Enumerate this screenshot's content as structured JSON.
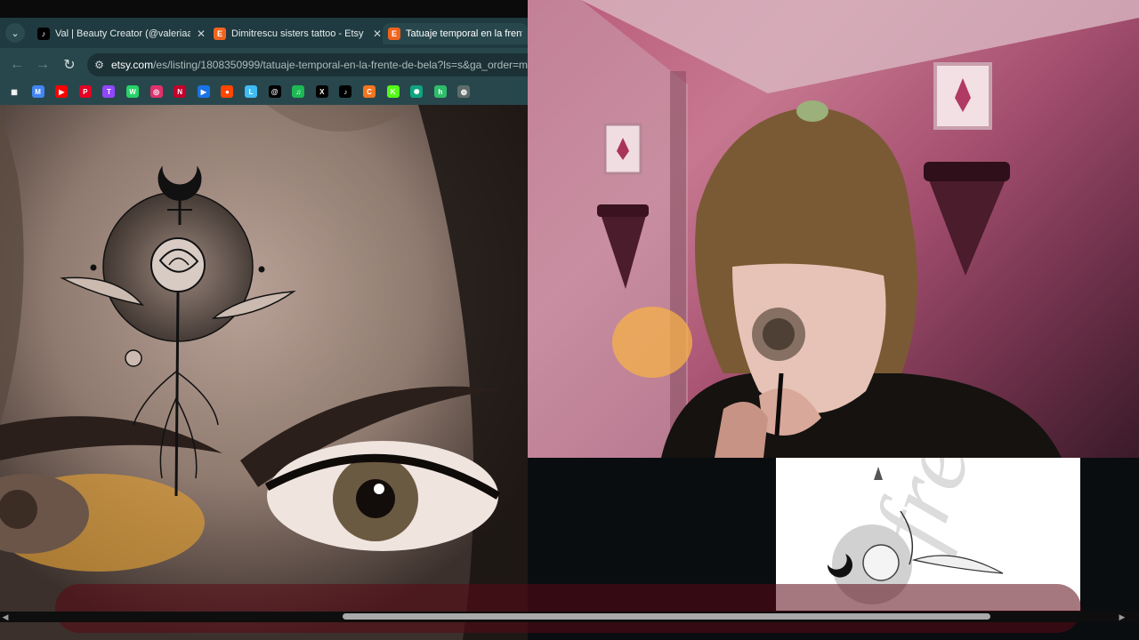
{
  "browser": {
    "tabs": [
      {
        "label": "Val | Beauty Creator (@valeriaa...",
        "icon": "tiktok-icon",
        "icon_bg": "#000000",
        "active": false
      },
      {
        "label": "Dimitrescu sisters tattoo - Etsy",
        "icon": "etsy-icon",
        "icon_bg": "#f1641e",
        "active": false
      },
      {
        "label": "Tatuaje temporal en la frente de",
        "icon": "etsy-icon",
        "icon_bg": "#f1641e",
        "active": true
      }
    ],
    "close_glyph": "✕",
    "etsy_letter": "E",
    "tiktok_letter": "♪",
    "menu_glyph": "⌄",
    "back_glyph": "←",
    "forward_glyph": "→",
    "reload_glyph": "↻",
    "site_info_glyph": "⚙",
    "url_host": "etsy.com",
    "url_path": "/es/listing/1808350999/tatuaje-temporal-en-la-frente-de-bela?ls=s&ga_order=m",
    "bookmarks": [
      {
        "name": "apps-icon",
        "color": "#28474d",
        "glyph": "▦"
      },
      {
        "name": "google-icon",
        "color": "#4285f4",
        "glyph": "M"
      },
      {
        "name": "youtube-icon",
        "color": "#ff0000",
        "glyph": "▶"
      },
      {
        "name": "pinterest-icon",
        "color": "#e60023",
        "glyph": "P"
      },
      {
        "name": "twitch-icon",
        "color": "#9146ff",
        "glyph": "T"
      },
      {
        "name": "whatsapp-icon",
        "color": "#25d366",
        "glyph": "W"
      },
      {
        "name": "instagram-icon",
        "color": "#e1306c",
        "glyph": "◎"
      },
      {
        "name": "bookmark-red-icon",
        "color": "#c4002b",
        "glyph": "N"
      },
      {
        "name": "video-icon",
        "color": "#1a73e8",
        "glyph": "▶"
      },
      {
        "name": "reddit-icon",
        "color": "#ff4500",
        "glyph": "●"
      },
      {
        "name": "letterboxd-icon",
        "color": "#40bcf4",
        "glyph": "L"
      },
      {
        "name": "threads-icon",
        "color": "#000000",
        "glyph": "@"
      },
      {
        "name": "spotify-icon",
        "color": "#1db954",
        "glyph": "♫"
      },
      {
        "name": "x-icon",
        "color": "#000000",
        "glyph": "X"
      },
      {
        "name": "tiktok-bookmark-icon",
        "color": "#000000",
        "glyph": "♪"
      },
      {
        "name": "crunchyroll-icon",
        "color": "#f47521",
        "glyph": "C"
      },
      {
        "name": "kick-icon",
        "color": "#53fc18",
        "glyph": "K"
      },
      {
        "name": "chatgpt-icon",
        "color": "#10a37f",
        "glyph": "✺"
      },
      {
        "name": "hotmart-icon",
        "color": "#2fbd6b",
        "glyph": "h"
      },
      {
        "name": "globe-icon",
        "color": "#5f6b6b",
        "glyph": "◍"
      }
    ]
  },
  "scrollbar": {
    "left_glyph": "◀",
    "right_glyph": "▶"
  },
  "colors": {
    "accent_tab": "#28474d",
    "etsy": "#f1641e"
  }
}
